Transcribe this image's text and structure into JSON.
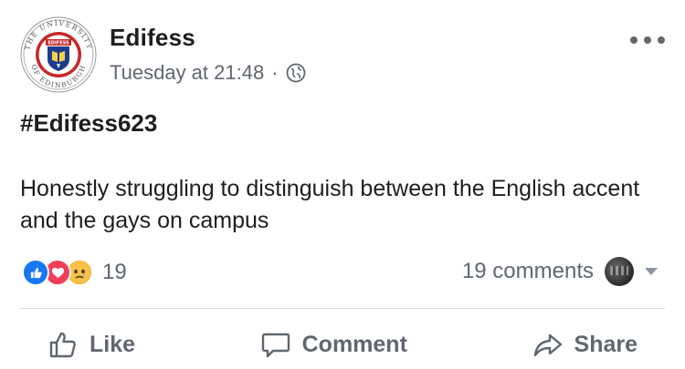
{
  "post": {
    "author": "Edifess",
    "timestamp": "Tuesday at 21:48",
    "separator": "·",
    "privacy_icon": "globe-icon",
    "hashtag": "#Edifess623",
    "text": "Honestly struggling to distinguish between the English accent and the gays on campus"
  },
  "avatar": {
    "ring_text": "THE UNIVERSITY OF EDINBURGH",
    "banner_text": "EDIFESS",
    "ring_color": "#b71c1c",
    "shield_color": "#1f3b8b"
  },
  "reactions": {
    "icons": [
      "like-reaction-icon",
      "love-reaction-icon",
      "sad-reaction-icon"
    ],
    "count": "19"
  },
  "comments": {
    "label": "19 comments"
  },
  "actions": {
    "like": "Like",
    "comment": "Comment",
    "share": "Share"
  },
  "colors": {
    "text": "#1c1e21",
    "secondary": "#606770",
    "like_blue": "#1877f2",
    "love_red": "#f33e58",
    "sad_yellow": "#f7b125"
  }
}
